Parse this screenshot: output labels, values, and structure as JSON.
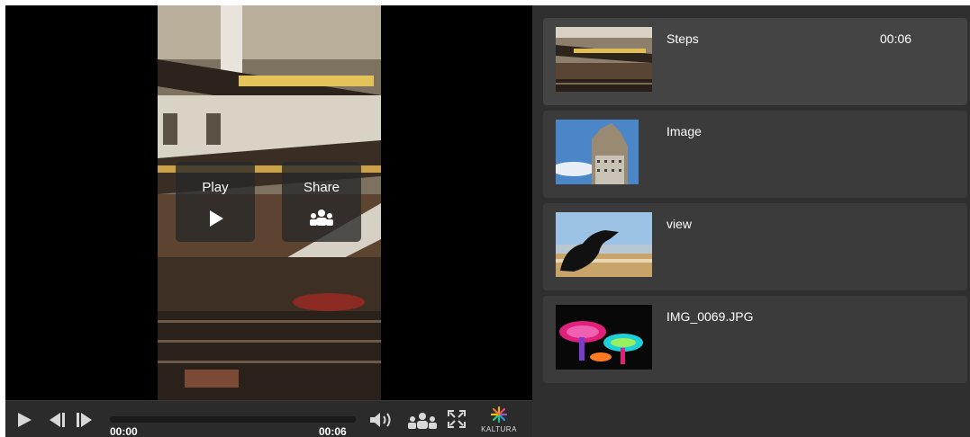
{
  "overlay": {
    "play_label": "Play",
    "share_label": "Share"
  },
  "controls": {
    "current_time": "00:00",
    "duration": "00:06",
    "progress": 0.0,
    "brand_text": "KALTURA",
    "icons": [
      "play-icon",
      "previous-icon",
      "next-icon",
      "volume-icon",
      "share-icon",
      "fullscreen-icon",
      "kaltura-logo-icon"
    ]
  },
  "playlist": {
    "items": [
      {
        "title": "Steps",
        "duration": "00:06",
        "active": true
      },
      {
        "title": "Image",
        "duration": "",
        "active": false
      },
      {
        "title": "view",
        "duration": "",
        "active": false
      },
      {
        "title": "IMG_0069.JPG",
        "duration": "",
        "active": false
      }
    ]
  },
  "colors": {
    "player_bg": "#000000",
    "controls_bg": "#2b2b2b",
    "playlist_bg": "#2f2f2f",
    "item_bg": "#3b3b3b",
    "progress_accent": "#4a90d9"
  }
}
